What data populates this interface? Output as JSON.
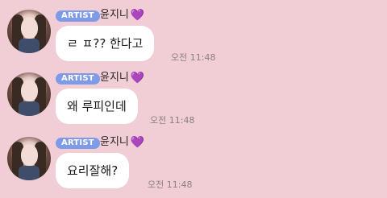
{
  "messages": [
    {
      "badge": "ARTIST",
      "sender": "윤지니",
      "heart": "💜",
      "text": "ㄹ ㅍ?? 한다고",
      "time": "오전 11:48"
    },
    {
      "badge": "ARTIST",
      "sender": "윤지니",
      "heart": "💜",
      "text": "왜 루피인데",
      "time": "오전 11:48"
    },
    {
      "badge": "ARTIST",
      "sender": "윤지니",
      "heart": "💜",
      "text": "요리잘해?",
      "time": "오전 11:48"
    }
  ]
}
